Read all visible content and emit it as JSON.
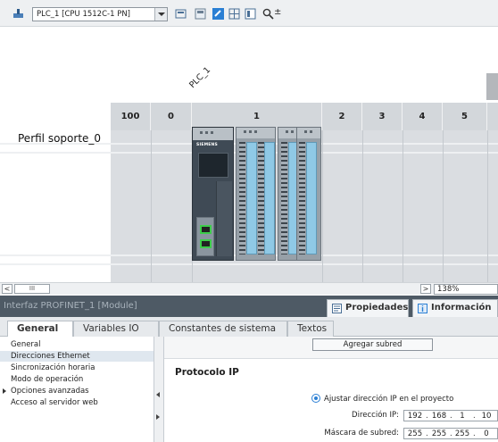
{
  "toolbar": {
    "device_selector": "PLC_1 [CPU 1512C-1 PN]",
    "zoom_glyph": "±"
  },
  "canvas": {
    "device_label": "PLC_1",
    "rack_name": "Perfil soporte_0",
    "slots": [
      "100",
      "0",
      "1",
      "2",
      "3",
      "4",
      "5"
    ],
    "cpu_brand": "SIEMENS",
    "port_color": "#3dcc4a"
  },
  "scrollbar": {
    "left_arrow": "<",
    "thumb_grip": "III",
    "right_arrow": ">",
    "zoom": "138%"
  },
  "inspector": {
    "title": "Interfaz PROFINET_1 [Module]",
    "tabs": [
      "Propiedades",
      "Información"
    ],
    "sub_tabs": [
      "General",
      "Variables IO",
      "Constantes de sistema",
      "Textos"
    ],
    "nav_items": [
      "General",
      "Direcciones Ethernet",
      "Sincronización horaria",
      "Modo de operación",
      "Opciones avanzadas",
      "Acceso al servidor web"
    ],
    "add_subnet_button": "Agregar subred",
    "section_title": "Protocolo IP",
    "radio_label": "Ajustar dirección IP en el proyecto",
    "ip_label": "Dirección IP:",
    "ip_octets": [
      "192",
      "168",
      "1",
      "10"
    ],
    "mask_label": "Máscara de subred:",
    "mask_octets": [
      "255",
      "255",
      "255",
      "0"
    ]
  }
}
